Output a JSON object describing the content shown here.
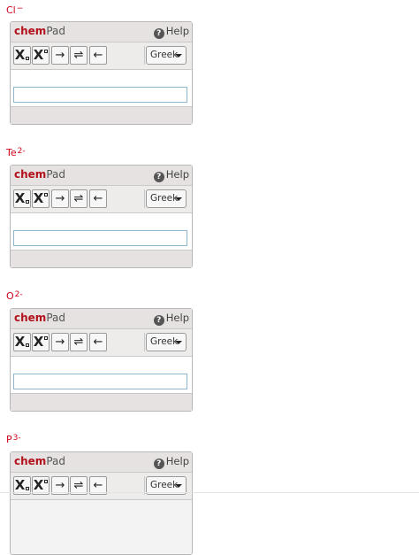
{
  "brand": {
    "chem": "chem",
    "pad": "Pad"
  },
  "help_label": "Help",
  "toolbar": {
    "subscript_letter": "X",
    "superscript_letter": "X",
    "right_arrow": "→",
    "equilibrium_arrow": "⇌",
    "left_arrow": "←",
    "greek_label": "Greek"
  },
  "questions": [
    {
      "symbol": "Cl",
      "charge": "−",
      "input_value": ""
    },
    {
      "symbol": "Te",
      "charge": "2-",
      "input_value": ""
    },
    {
      "symbol": "O",
      "charge": "2-",
      "input_value": ""
    },
    {
      "symbol": "P",
      "charge": "3-",
      "input_value": ""
    }
  ],
  "colors": {
    "label": "#d0021b",
    "brand_chem": "#b3111c",
    "input_border": "#8fb6cf"
  }
}
